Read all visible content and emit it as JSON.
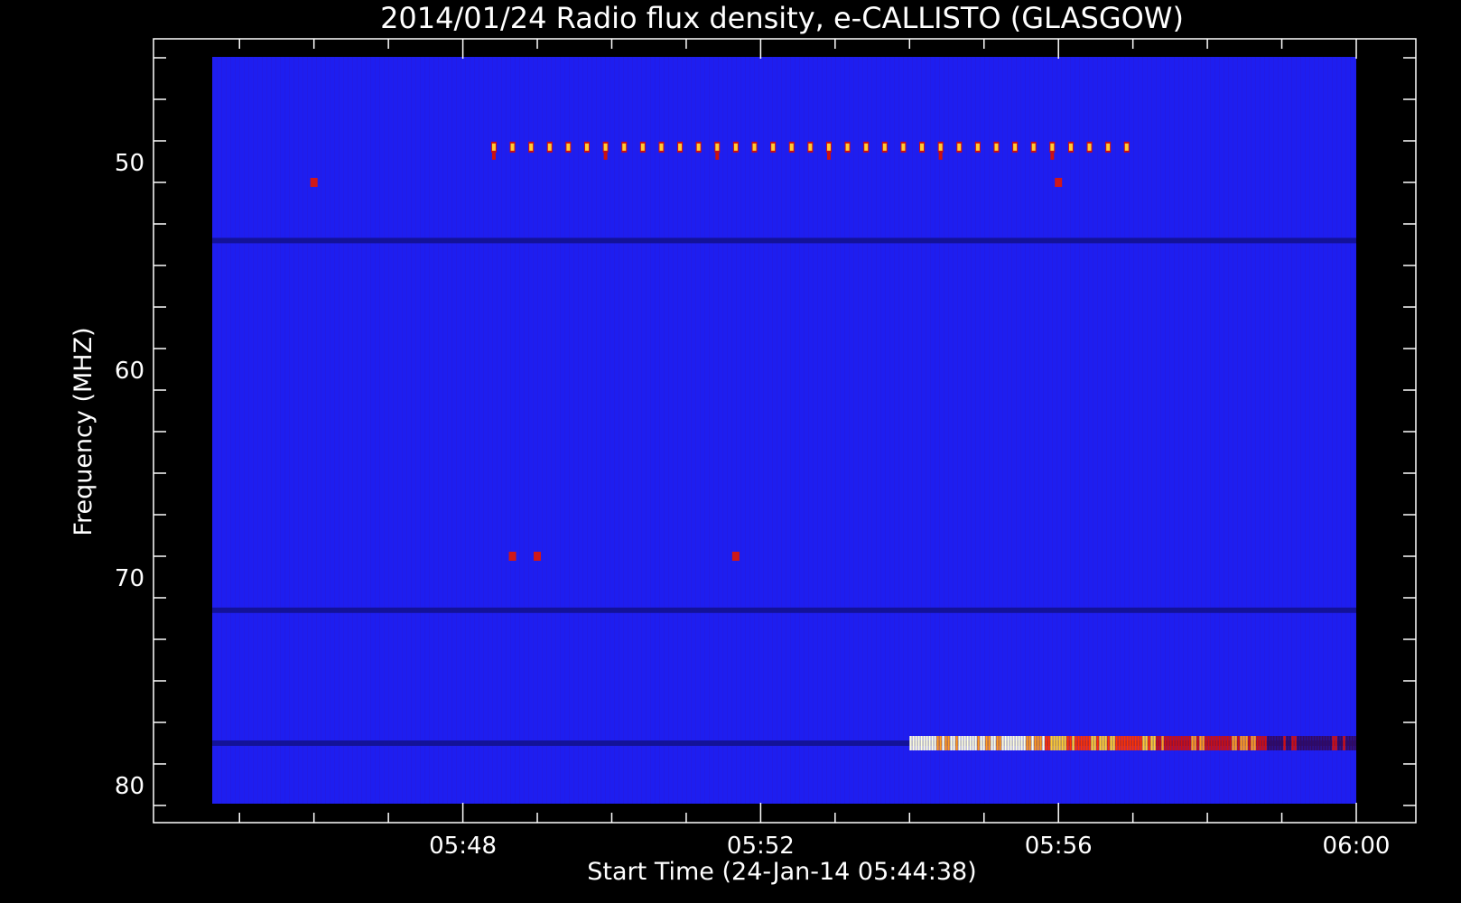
{
  "chart_data": {
    "type": "heatmap",
    "title": "2014/01/24  Radio flux density, e-CALLISTO (GLASGOW)",
    "xlabel": "Start Time (24-Jan-14 05:44:38)",
    "ylabel": "Frequency (MHZ)",
    "x_range_minutes": [
      "05:44:38",
      "06:00:00"
    ],
    "y_range_mhz": [
      45,
      81
    ],
    "y_inverted": true,
    "x_ticks": [
      "05:48",
      "05:52",
      "05:56",
      "06:00"
    ],
    "y_ticks": [
      50,
      60,
      70,
      80
    ],
    "colormap": [
      "#000000",
      "#1a00ff",
      "#cc1010",
      "#ff3300",
      "#ffcc33",
      "#ffffdd"
    ],
    "background_color": "#1e1ef0",
    "features": [
      {
        "kind": "pulse_train",
        "freq_mhz": 49.3,
        "start": "05:48:25",
        "end": "05:57:05",
        "period_sec": 15,
        "intensity": "yellow"
      },
      {
        "kind": "burst_band",
        "freq_mhz": 78.0,
        "start": "05:54:00",
        "end": "06:00:00",
        "intensity": "yellow-red"
      },
      {
        "kind": "dark_band",
        "freq_mhz": 53.8
      },
      {
        "kind": "dark_band",
        "freq_mhz": 78.0
      },
      {
        "kind": "dark_band",
        "freq_mhz": 71.6
      },
      {
        "kind": "red_dots",
        "freq_mhz": 69.0,
        "times": [
          "05:48:40",
          "05:49:00",
          "05:51:40"
        ]
      },
      {
        "kind": "red_dots",
        "freq_mhz": 51.0,
        "times": [
          "05:46:00",
          "05:56:00"
        ]
      }
    ]
  }
}
